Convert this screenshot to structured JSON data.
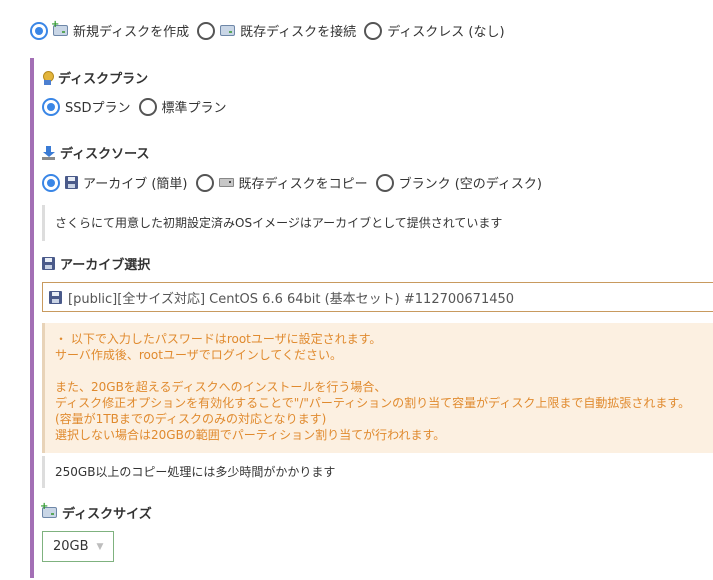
{
  "disk_mode": {
    "options": [
      {
        "label": "新規ディスクを作成",
        "icon": "disk-plus-icon",
        "selected": true
      },
      {
        "label": "既存ディスクを接続",
        "icon": "disk-icon",
        "selected": false
      },
      {
        "label": "ディスクレス (なし)",
        "selected": false
      }
    ]
  },
  "disk_plan": {
    "title": "ディスクプラン",
    "icon": "medal-icon",
    "options": [
      {
        "label": "SSDプラン",
        "selected": true
      },
      {
        "label": "標準プラン",
        "selected": false
      }
    ]
  },
  "disk_source": {
    "title": "ディスクソース",
    "icon": "download-icon",
    "options": [
      {
        "label": "アーカイブ (簡単)",
        "icon": "floppy-icon",
        "selected": true
      },
      {
        "label": "既存ディスクをコピー",
        "icon": "hdd-icon",
        "selected": false
      },
      {
        "label": "ブランク (空のディスク)",
        "selected": false
      }
    ],
    "note": "さくらにて用意した初期設定済みOSイメージはアーカイブとして提供されています"
  },
  "archive": {
    "title": "アーカイブ選択",
    "icon": "floppy-icon",
    "selected_value": "[public][全サイズ対応] CentOS 6.6 64bit (基本セット) #112700671450"
  },
  "warning": {
    "color": "#e08a2e",
    "background": "#fcf0e1",
    "lines": [
      "・ 以下で入力したパスワードはrootユーザに設定されます。",
      "サーバ作成後、rootユーザでログインしてください。",
      "",
      "また、20GBを超えるディスクへのインストールを行う場合、",
      "ディスク修正オプションを有効化することで\"/\"パーティションの割り当て容量がディスク上限まで自動拡張されます。",
      "(容量が1TBまでのディスクのみの対応となります)",
      "選択しない場合は20GBの範囲でパーティション割り当てが行われます。"
    ]
  },
  "copy_note": "250GB以上のコピー処理には多少時間がかかります",
  "disk_size": {
    "title": "ディスクサイズ",
    "icon": "disk-plus-icon",
    "selected_value": "20GB"
  },
  "colors": {
    "accent": "#3a86e6",
    "panel_border": "#a36fb5",
    "select_border": "#c89a5e"
  }
}
